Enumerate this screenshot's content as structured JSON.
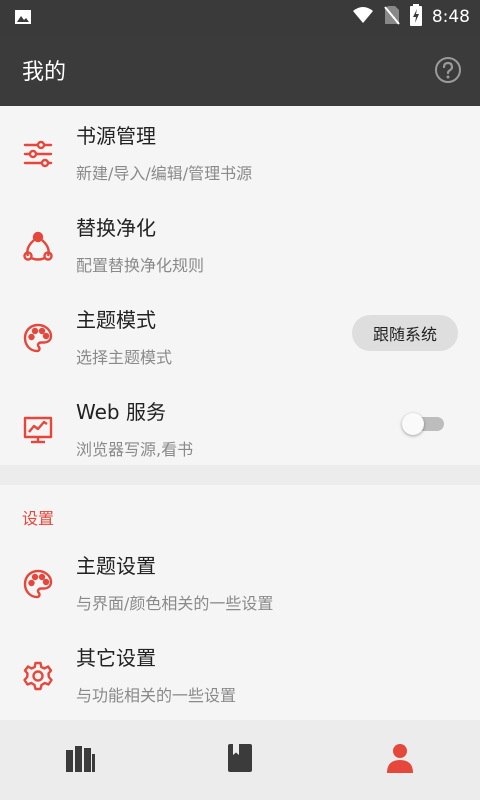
{
  "status_bar": {
    "time": "8:48",
    "icons": [
      "image-icon",
      "wifi-icon",
      "no-sim-icon",
      "battery-charging-icon"
    ]
  },
  "app_bar": {
    "title": "我的",
    "help_icon": "help-circle-icon"
  },
  "colors": {
    "accent": "#e5473b",
    "app_bar": "#3b3b3b",
    "background": "#f5f5f5"
  },
  "items": [
    {
      "title": "书源管理",
      "subtitle": "新建/导入/编辑/管理书源",
      "icon": "sliders-icon"
    },
    {
      "title": "替换净化",
      "subtitle": "配置替换净化规则",
      "icon": "triangle-nodes-icon"
    },
    {
      "title": "主题模式",
      "subtitle": "选择主题模式",
      "icon": "palette-icon",
      "chip": "跟随系统"
    },
    {
      "title": "Web 服务",
      "subtitle": "浏览器写源,看书",
      "icon": "monitor-icon",
      "switch_on": false
    }
  ],
  "settings": {
    "section_title": "设置",
    "items": [
      {
        "title": "主题设置",
        "subtitle": "与界面/颜色相关的一些设置",
        "icon": "palette-icon"
      },
      {
        "title": "其它设置",
        "subtitle": "与功能相关的一些设置",
        "icon": "gear-icon"
      }
    ]
  },
  "bottom_nav": [
    {
      "name": "bookshelf",
      "icon": "bookshelf-icon",
      "active": false
    },
    {
      "name": "explore",
      "icon": "book-icon",
      "active": false
    },
    {
      "name": "my",
      "icon": "person-icon",
      "active": true
    }
  ]
}
